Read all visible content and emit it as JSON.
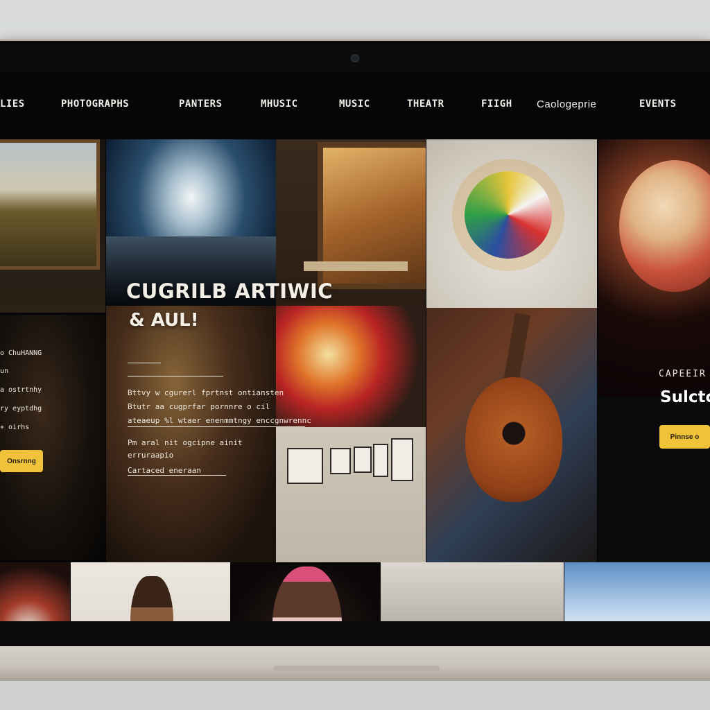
{
  "nav": {
    "items": [
      "LIES",
      "PHOTOGRAPHS",
      "PANTERS",
      "MHUSIC",
      "MUSIC",
      "THEATR",
      "FIIGH",
      "Caologeprie",
      "EVENTS"
    ]
  },
  "hero": {
    "title": "CUGRILB ARTIWIC",
    "subtitle": "& AUL!",
    "lines": [
      "Bttvy w cgurerl fprtnst ontiansten",
      "Btutr aa cugprfar pornnre o cil",
      "ateaeup %l wtaer enenmmtngy enccgnwrennc",
      "Pm aral nit ogcipne ainit",
      "erruraapio",
      "Cartaced eneraan"
    ]
  },
  "left_panel": {
    "lines": [
      "o ChuHANNG",
      "un",
      "a ostrtnhy",
      "ry eyptdhg",
      "+ oirhs"
    ],
    "button_label": "Onsrnng"
  },
  "side_panel": {
    "label": "CAPEEIR",
    "heading": "Sulctc",
    "button_label": "Pinnse o"
  }
}
